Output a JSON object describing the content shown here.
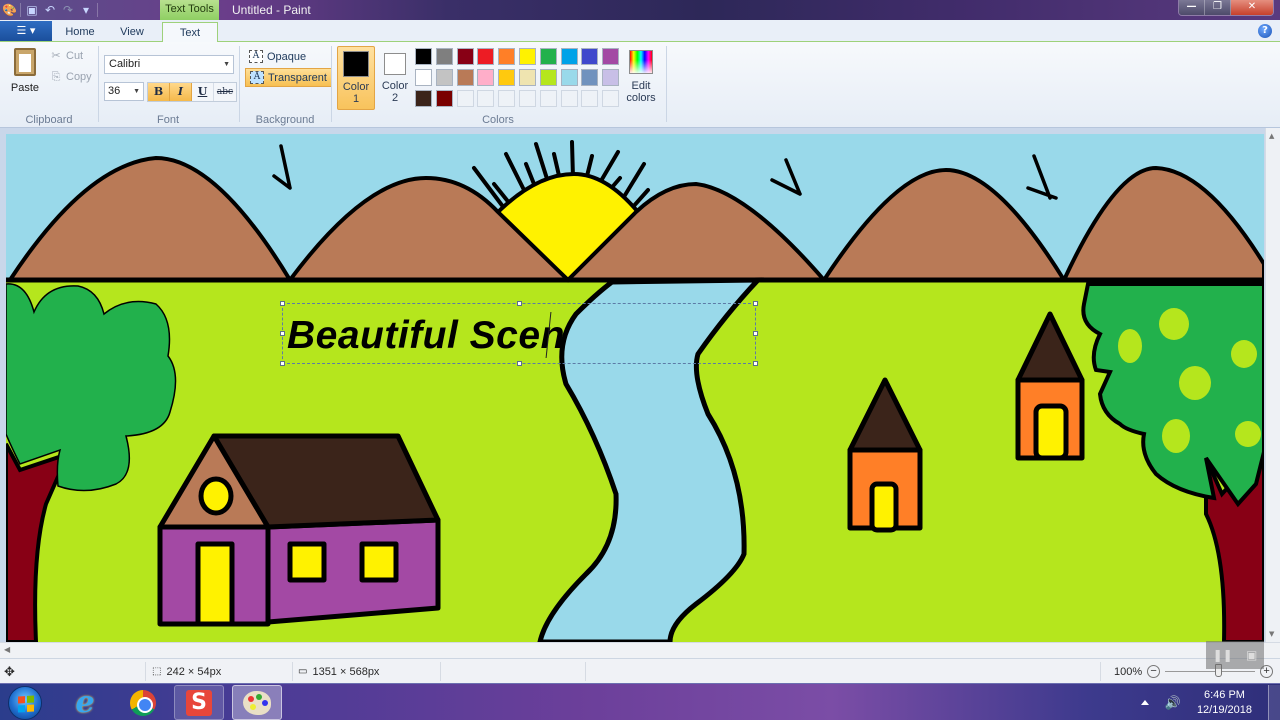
{
  "window": {
    "title": "Untitled - Paint",
    "context_tab": "Text Tools",
    "controls": [
      "minimize",
      "maximize",
      "close"
    ]
  },
  "quick_access": [
    "paint-app-icon",
    "save-icon",
    "undo-icon",
    "redo-icon",
    "customize-icon"
  ],
  "tabs": [
    {
      "label": "Home",
      "active": false
    },
    {
      "label": "View",
      "active": false
    },
    {
      "label": "Text",
      "active": true
    }
  ],
  "ribbon": {
    "clipboard": {
      "label": "Clipboard",
      "paste": "Paste",
      "cut": "Cut",
      "copy": "Copy"
    },
    "font": {
      "label": "Font",
      "family": "Calibri",
      "size": "36",
      "bold": {
        "label": "B",
        "on": true
      },
      "italic": {
        "label": "I",
        "on": true
      },
      "underline": {
        "label": "U",
        "on": false
      },
      "strikethrough": {
        "label": "abc",
        "on": false
      }
    },
    "background": {
      "label": "Background",
      "opaque": "Opaque",
      "transparent": "Transparent",
      "selected": "Transparent"
    },
    "colors": {
      "label": "Colors",
      "color1": {
        "label_line1": "Color",
        "label_line2": "1",
        "value": "#000000"
      },
      "color2": {
        "label_line1": "Color",
        "label_line2": "2",
        "value": "#ffffff"
      },
      "edit_line1": "Edit",
      "edit_line2": "colors",
      "palette": [
        "#000000",
        "#7f7f7f",
        "#880015",
        "#ed1c24",
        "#ff7f27",
        "#fff200",
        "#22b14c",
        "#00a2e8",
        "#3f48cc",
        "#a349a4",
        "#ffffff",
        "#c3c3c3",
        "#b97a57",
        "#ffaec9",
        "#ffc90e",
        "#efe4b0",
        "#b5e61d",
        "#99d9ea",
        "#7092be",
        "#c8bfe7",
        "#3b241a",
        "#7a0000",
        "",
        "",
        "",
        "",
        "",
        "",
        "",
        ""
      ]
    }
  },
  "canvas": {
    "text_box": "Beautiful Scen",
    "scene_colors": {
      "sky": "#99d9ea",
      "mountain": "#b97a57",
      "grass": "#b5e61d",
      "sun": "#fff200",
      "tree_green": "#22b14c",
      "trunk": "#880015",
      "house_purple": "#a349a4",
      "roof_dark": "#3b241a",
      "hut_orange": "#ff7f27",
      "river": "#99d9ea"
    }
  },
  "status": {
    "selection_size": "242 × 54px",
    "canvas_size": "1351 × 568px",
    "zoom": "100%"
  },
  "taskbar": {
    "apps": [
      "internet-explorer",
      "google-chrome",
      "snagit",
      "paint"
    ],
    "time": "6:46 PM",
    "date": "12/19/2018"
  }
}
